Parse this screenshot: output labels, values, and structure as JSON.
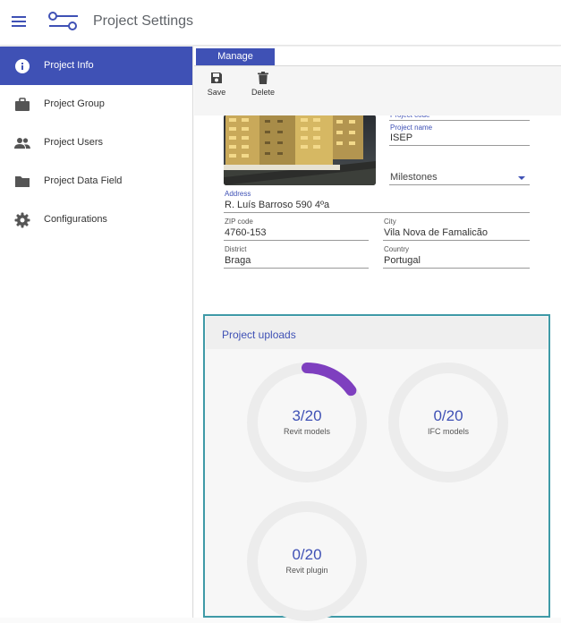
{
  "app": {
    "title": "Project Settings"
  },
  "sidebar": {
    "items": [
      {
        "label": "Project Info",
        "icon": "info-icon",
        "active": true
      },
      {
        "label": "Project Group",
        "icon": "briefcase-icon",
        "active": false
      },
      {
        "label": "Project Users",
        "icon": "people-icon",
        "active": false
      },
      {
        "label": "Project Data Field",
        "icon": "folder-icon",
        "active": false
      },
      {
        "label": "Configurations",
        "icon": "gear-icon",
        "active": false
      }
    ]
  },
  "tabs": {
    "manage": "Manage"
  },
  "toolbar": {
    "save_label": "Save",
    "delete_label": "Delete"
  },
  "form": {
    "project_code": {
      "label": "Project code",
      "value": ""
    },
    "project_name": {
      "label": "Project name",
      "value": "ISEP"
    },
    "milestones": {
      "value": "Milestones"
    },
    "address": {
      "label": "Address",
      "value": "R. Luís Barroso 590 4ºa"
    },
    "zip": {
      "label": "ZIP code",
      "value": "4760-153"
    },
    "city": {
      "label": "City",
      "value": "Vila Nova de Famalicão"
    },
    "district": {
      "label": "District",
      "value": "Braga"
    },
    "country": {
      "label": "Country",
      "value": "Portugal"
    }
  },
  "uploads": {
    "title": "Project uploads",
    "accent_color": "#7e3fbf",
    "gauges": [
      {
        "label": "Revit models",
        "count": 3,
        "max": 20,
        "text": "3/20"
      },
      {
        "label": "IFC models",
        "count": 0,
        "max": 20,
        "text": "0/20"
      },
      {
        "label": "Revit plugin",
        "count": 0,
        "max": 20,
        "text": "0/20"
      }
    ]
  },
  "colors": {
    "primary": "#3f51b5",
    "panel_border": "#3f9aa7"
  }
}
